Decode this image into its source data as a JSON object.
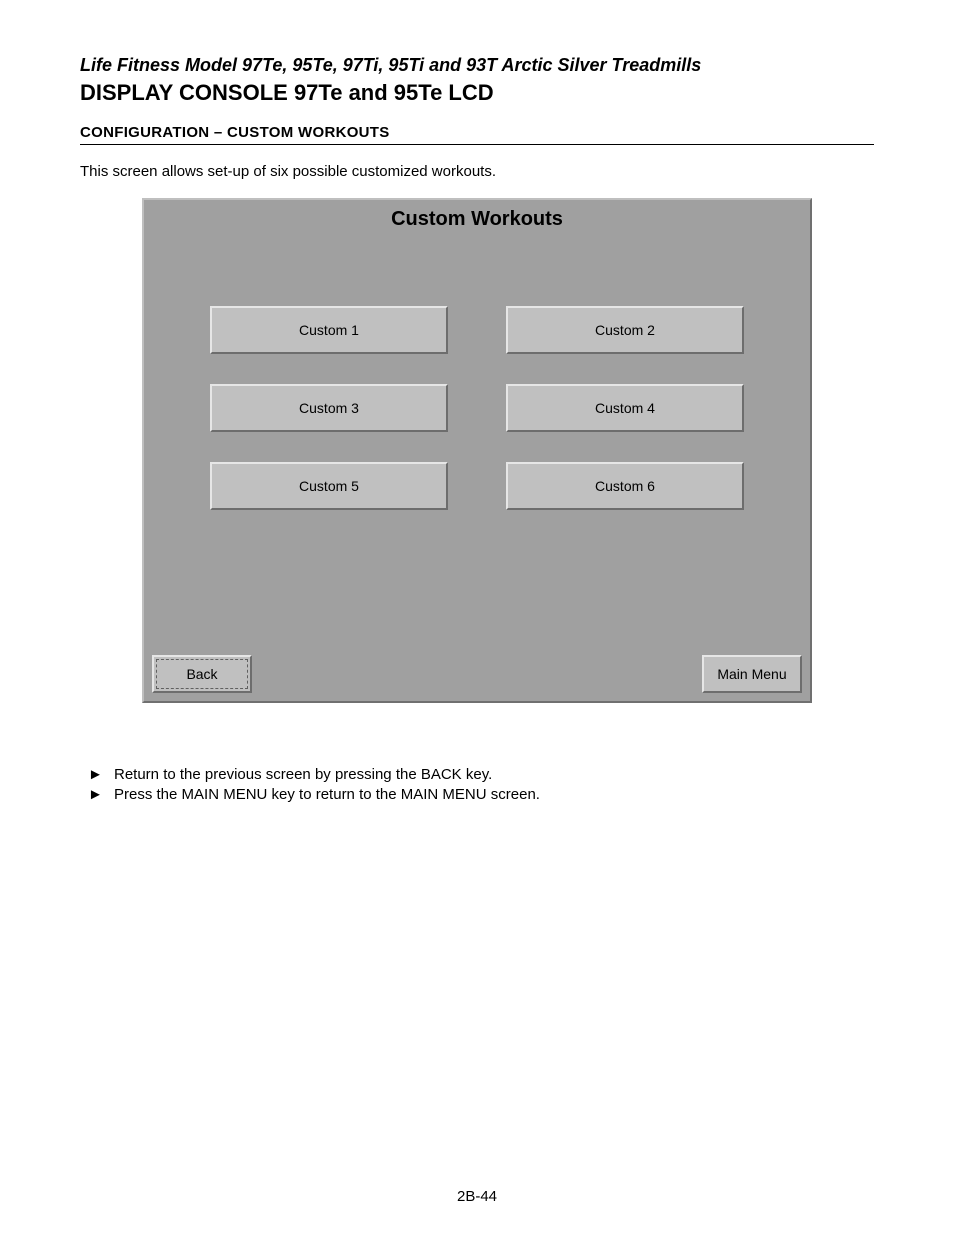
{
  "doc": {
    "subtitle": "Life Fitness Model 97Te, 95Te, 97Ti, 95Ti and 93T Arctic Silver Treadmills",
    "title": "DISPLAY CONSOLE 97Te and 95Te LCD",
    "section_heading": "CONFIGURATION – CUSTOM WORKOUTS",
    "intro": "This screen allows set-up of six possible customized workouts.",
    "page_number": "2B-44"
  },
  "screen": {
    "title": "Custom Workouts",
    "buttons": {
      "b1": "Custom 1",
      "b2": "Custom 2",
      "b3": "Custom 3",
      "b4": "Custom 4",
      "b5": "Custom 5",
      "b6": "Custom 6"
    },
    "back_label": "Back",
    "main_menu_label": "Main Menu"
  },
  "bullets": {
    "marker": "►",
    "b1": "Return to the previous screen by pressing the BACK key.",
    "b2": "Press the MAIN MENU key to return to the MAIN MENU screen."
  }
}
